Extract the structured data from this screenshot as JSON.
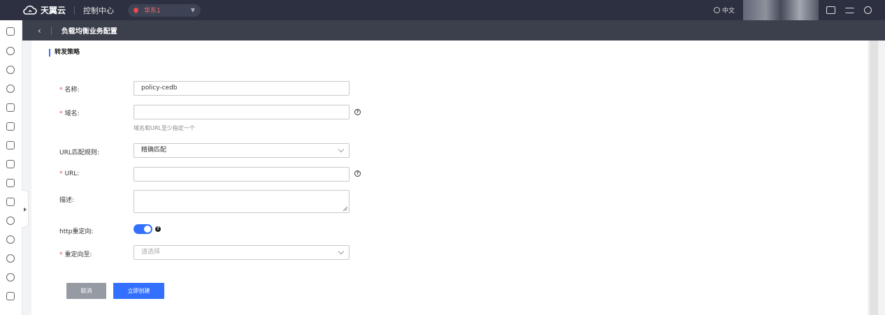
{
  "topbar": {
    "brand": "天翼云",
    "console": "控制中心",
    "region": "华东1",
    "language": "中文"
  },
  "subheader": {
    "back_icon": "‹",
    "title": "负载均衡业务配置"
  },
  "form": {
    "section_title": "转发策略",
    "name": {
      "label": "名称:",
      "value": "policy-cedb",
      "required": true
    },
    "domain": {
      "label": "域名:",
      "value": "",
      "required": true,
      "hint": "域名和URL至少指定一个"
    },
    "url_match": {
      "label": "URL匹配规则:",
      "value": "精确匹配"
    },
    "url": {
      "label": "URL:",
      "value": "",
      "required": true
    },
    "description": {
      "label": "描述:",
      "value": ""
    },
    "http_redirect": {
      "label": "http重定向:",
      "enabled": true
    },
    "redirect_to": {
      "label": "重定向至:",
      "placeholder": "请选择",
      "required": true
    },
    "required_mark": "*",
    "help_mark": "?"
  },
  "buttons": {
    "cancel": "取消",
    "create": "立即创建"
  },
  "colors": {
    "primary": "#3370ff",
    "topbar": "#2c3040",
    "subheader": "#3c404d",
    "required": "#e84a4a"
  }
}
